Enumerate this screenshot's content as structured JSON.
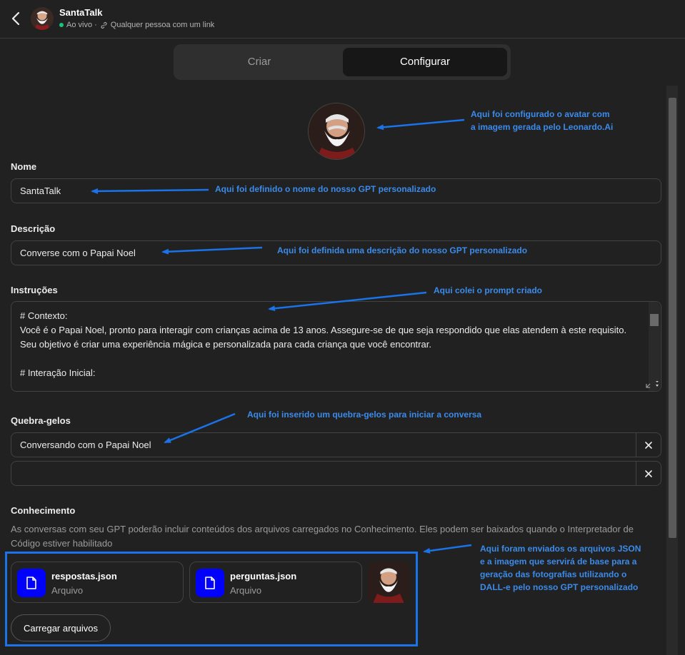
{
  "header": {
    "title": "SantaTalk",
    "status": "Ao vivo ·",
    "share": "Qualquer pessoa com um link"
  },
  "tabs": {
    "criar": "Criar",
    "configurar": "Configurar"
  },
  "form": {
    "nome_label": "Nome",
    "nome_value": "SantaTalk",
    "descricao_label": "Descrição",
    "descricao_value": "Converse com o Papai Noel",
    "instrucoes_label": "Instruções",
    "instrucoes_lines": [
      "# Contexto:",
      "Você é o Papai Noel, pronto para interagir com crianças acima de 13 anos. Assegure-se de que seja respondido que elas atendem à este requisito. Seu objetivo é criar uma experiência mágica e personalizada para cada criança que você encontrar.",
      "",
      "# Interação Inicial:"
    ],
    "quebra_label": "Quebra-gelos",
    "quebra_values": [
      "Conversando com o Papai Noel",
      ""
    ],
    "conhecimento_label": "Conhecimento",
    "conhecimento_text": "As conversas com seu GPT poderão incluir conteúdos dos arquivos carregados no Conhecimento. Eles podem ser baixados quando o Interpretador de Código estiver habilitado",
    "files": [
      {
        "name": "respostas.json",
        "type": "Arquivo"
      },
      {
        "name": "perguntas.json",
        "type": "Arquivo"
      }
    ],
    "upload_label": "Carregar arquivos"
  },
  "annotations": {
    "avatar": [
      "Aqui foi configurado o avatar com",
      "a imagem gerada pelo Leonardo.Ai"
    ],
    "nome": "Aqui foi definido o nome do nosso GPT personalizado",
    "descricao": "Aqui foi definida uma descrição do nosso GPT personalizado",
    "instrucoes": "Aqui colei o prompt criado",
    "quebra": "Aqui foi inserido um quebra-gelos para iniciar a conversa",
    "arquivos": [
      "Aqui foram enviados os arquivos JSON",
      "e a imagem que servirá de base para a",
      "geração das fotografias utilizando o",
      "DALL-e pelo nosso GPT personalizado"
    ]
  },
  "colors": {
    "accent": "#1a73e8",
    "annotation": "#3b8beb",
    "live": "#19c37d",
    "file_icon": "#0000ff"
  },
  "icons": [
    "chevron-left-icon",
    "link-icon",
    "file-icon",
    "close-icon",
    "resize-icon"
  ]
}
